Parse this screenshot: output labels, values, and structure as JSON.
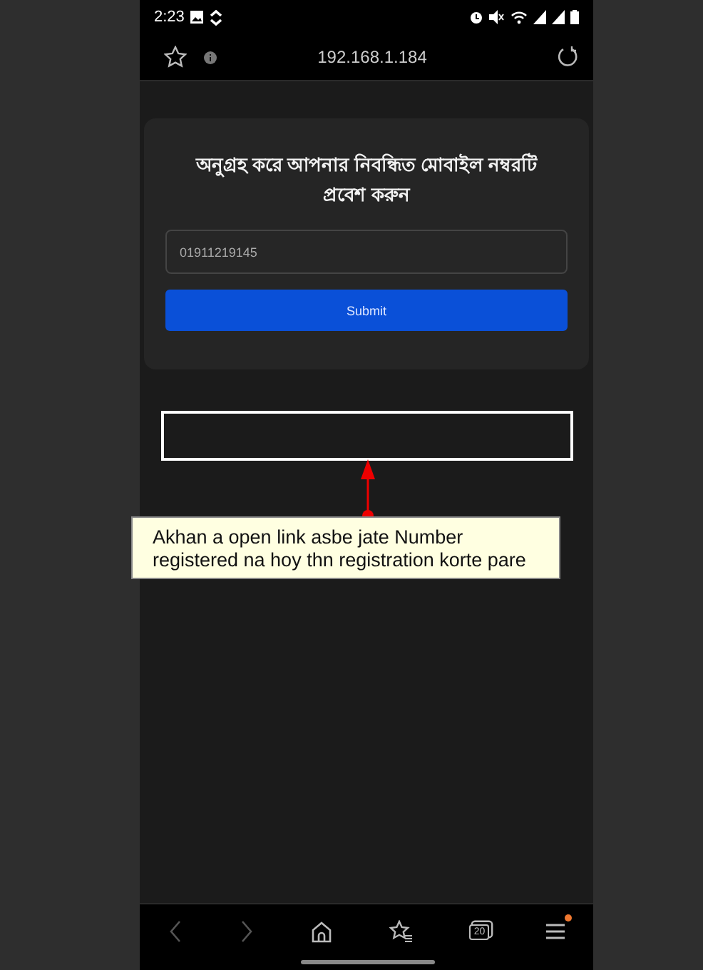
{
  "status_bar": {
    "time": "2:23"
  },
  "address_bar": {
    "url": "192.168.1.184"
  },
  "form": {
    "title": "অনুগ্রহ করে আপনার নিবন্ধিত মোবাইল নম্বরটি প্রবেশ করুন",
    "phone": {
      "value": "01911219145"
    },
    "submit": "Submit"
  },
  "annotation": {
    "text": "Akhan a open link asbe jate Number registered na hoy thn registration korte pare"
  },
  "bottom_nav": {
    "tab_count": "20",
    "menu_badge": true
  }
}
